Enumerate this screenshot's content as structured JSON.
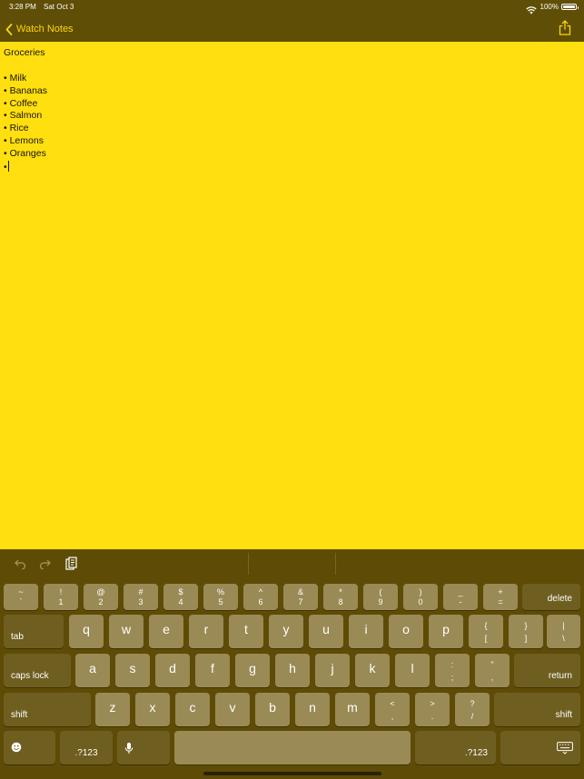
{
  "status": {
    "time": "3:28 PM",
    "date": "Sat Oct 3",
    "battery": "100%"
  },
  "nav": {
    "back_label": "Watch Notes"
  },
  "note": {
    "title": "Groceries",
    "items": [
      "• Milk",
      "• Bananas",
      "• Coffee",
      "• Salmon",
      "• Rice",
      "• Lemons",
      "• Oranges"
    ],
    "current_line": "•"
  },
  "keyboard": {
    "row1": [
      {
        "top": "~",
        "bot": "`"
      },
      {
        "top": "!",
        "bot": "1"
      },
      {
        "top": "@",
        "bot": "2"
      },
      {
        "top": "#",
        "bot": "3"
      },
      {
        "top": "$",
        "bot": "4"
      },
      {
        "top": "%",
        "bot": "5"
      },
      {
        "top": "^",
        "bot": "6"
      },
      {
        "top": "&",
        "bot": "7"
      },
      {
        "top": "*",
        "bot": "8"
      },
      {
        "top": "(",
        "bot": "9"
      },
      {
        "top": ")",
        "bot": "0"
      },
      {
        "top": "_",
        "bot": "-"
      },
      {
        "top": "+",
        "bot": "="
      }
    ],
    "delete": "delete",
    "tab": "tab",
    "row2": [
      "q",
      "w",
      "e",
      "r",
      "t",
      "y",
      "u",
      "i",
      "o",
      "p"
    ],
    "row2_sym": [
      {
        "top": "{",
        "bot": "["
      },
      {
        "top": "}",
        "bot": "]"
      },
      {
        "top": "|",
        "bot": "\\"
      }
    ],
    "caps": "caps lock",
    "row3": [
      "a",
      "s",
      "d",
      "f",
      "g",
      "h",
      "j",
      "k",
      "l"
    ],
    "row3_sym": [
      {
        "top": ":",
        "bot": ";"
      },
      {
        "top": "\"",
        "bot": ","
      }
    ],
    "return": "return",
    "shift_left": "shift",
    "row4": [
      "z",
      "x",
      "c",
      "v",
      "b",
      "n",
      "m"
    ],
    "row4_sym": [
      {
        "top": "<",
        "bot": ","
      },
      {
        "top": ">",
        "bot": "."
      },
      {
        "top": "?",
        "bot": "/"
      }
    ],
    "shift_right": "shift",
    "num_left": ".?123",
    "num_right": ".?123"
  },
  "icons": {
    "back": "chevron-left-icon",
    "share": "share-icon",
    "undo": "undo-icon",
    "redo": "redo-icon",
    "paste": "paste-icon",
    "emoji": "emoji-icon",
    "mic": "microphone-icon",
    "dismiss": "keyboard-dismiss-icon"
  },
  "colors": {
    "note_bg": "#ffdf10",
    "bar_bg": "#5f4e05",
    "accent": "#ffd60a",
    "key": "#9a8a55",
    "key_dark": "#6e5e20"
  }
}
